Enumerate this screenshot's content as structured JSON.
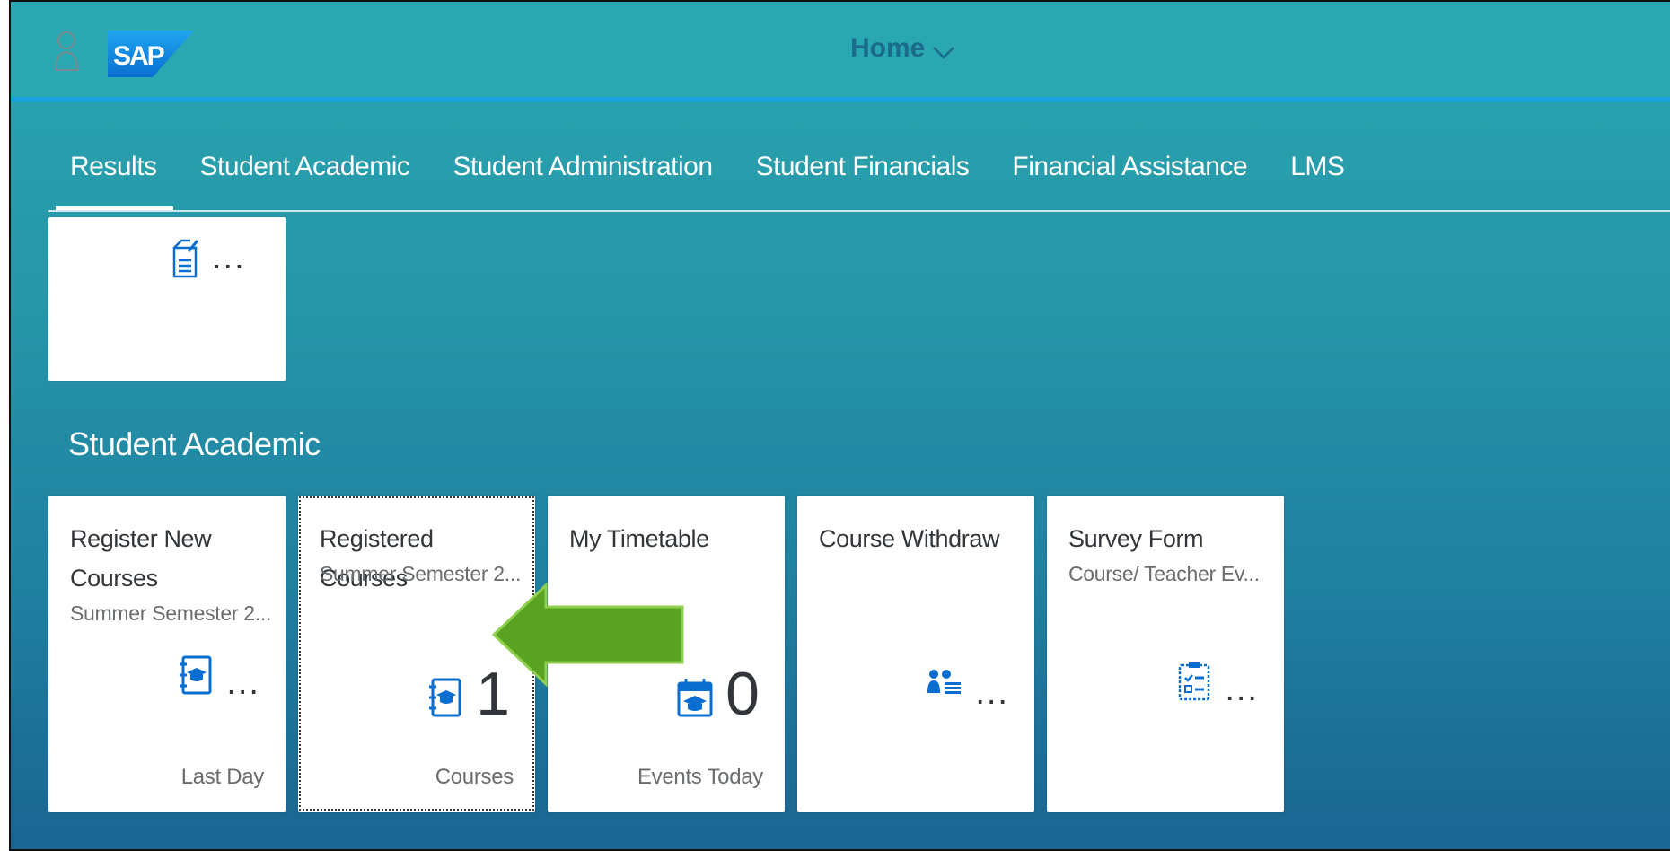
{
  "shell": {
    "title": "Home",
    "logo_text": "SAP"
  },
  "anchor_tabs": [
    {
      "label": "Results",
      "active": true
    },
    {
      "label": "Student Academic",
      "active": false
    },
    {
      "label": "Student Administration",
      "active": false
    },
    {
      "label": "Student Financials",
      "active": false
    },
    {
      "label": "Financial Assistance",
      "active": false
    },
    {
      "label": "LMS",
      "active": false
    }
  ],
  "results_tile": {
    "icon": "clipboard-edit-icon",
    "value": "..."
  },
  "group": {
    "title": "Student Academic"
  },
  "tiles": [
    {
      "title": "Register New Courses",
      "subtitle": "Summer Semester 2...",
      "icon": "course-book-icon",
      "value": "...",
      "footer": "Last Day"
    },
    {
      "title": "Registered Courses",
      "subtitle": "Summer Semester 2...",
      "icon": "course-book-icon",
      "value": "1",
      "footer": "Courses"
    },
    {
      "title": "My Timetable",
      "subtitle": "",
      "icon": "calendar-education-icon",
      "value": "0",
      "footer": "Events Today"
    },
    {
      "title": "Course Withdraw",
      "subtitle": "",
      "icon": "people-list-icon",
      "value": "...",
      "footer": ""
    },
    {
      "title": "Survey Form",
      "subtitle": "Course/ Teacher Ev...",
      "icon": "checklist-icon",
      "value": "...",
      "footer": ""
    }
  ],
  "colors": {
    "accent": "#0a6ed1",
    "shell_bg": "#2aa8b1",
    "arrow_fill": "#5aa322"
  }
}
